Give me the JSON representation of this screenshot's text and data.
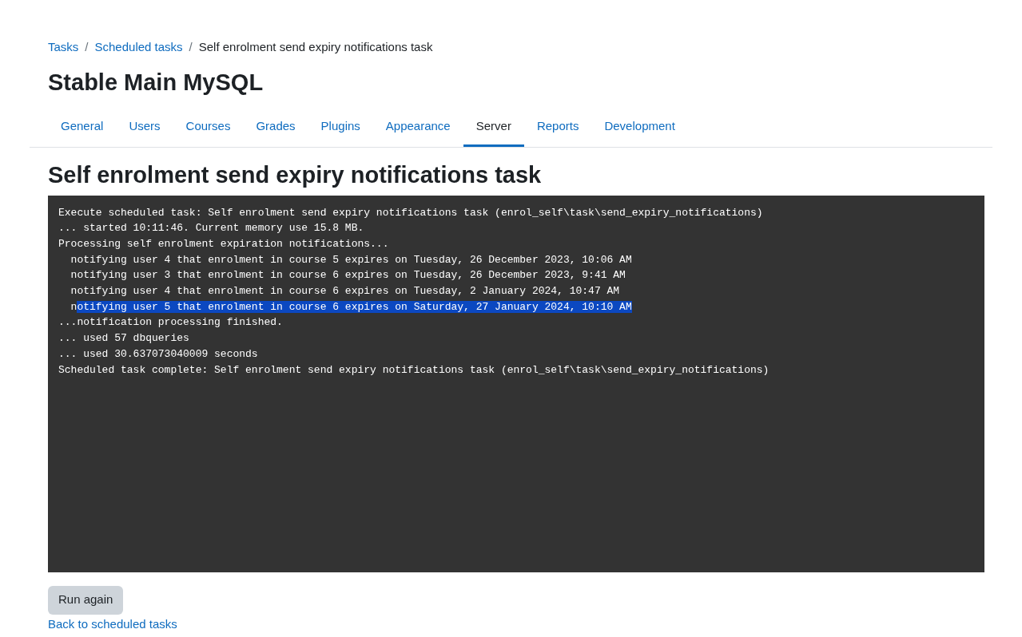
{
  "breadcrumb": [
    {
      "label": "Tasks",
      "link": true
    },
    {
      "label": "Scheduled tasks",
      "link": true
    },
    {
      "label": "Self enrolment send expiry notifications task",
      "link": false
    }
  ],
  "breadcrumb_separator": "/",
  "site_title": "Stable Main MySQL",
  "tabs": [
    {
      "label": "General",
      "selected": false
    },
    {
      "label": "Users",
      "selected": false
    },
    {
      "label": "Courses",
      "selected": false
    },
    {
      "label": "Grades",
      "selected": false
    },
    {
      "label": "Plugins",
      "selected": false
    },
    {
      "label": "Appearance",
      "selected": false
    },
    {
      "label": "Server",
      "selected": true
    },
    {
      "label": "Reports",
      "selected": false
    },
    {
      "label": "Development",
      "selected": false
    }
  ],
  "heading": "Self enrolment send expiry notifications task",
  "output_lines": [
    {
      "segments": [
        {
          "text": "Execute scheduled task: Self enrolment send expiry notifications task (enrol_self\\task\\send_expiry_notifications)",
          "highlighted": false
        }
      ]
    },
    {
      "segments": [
        {
          "text": "... started 10:11:46. Current memory use 15.8 MB.",
          "highlighted": false
        }
      ]
    },
    {
      "segments": [
        {
          "text": "Processing self enrolment expiration notifications...",
          "highlighted": false
        }
      ]
    },
    {
      "segments": [
        {
          "text": "  notifying user 4 that enrolment in course 5 expires on Tuesday, 26 December 2023, 10:06 AM",
          "highlighted": false
        }
      ]
    },
    {
      "segments": [
        {
          "text": "  notifying user 3 that enrolment in course 6 expires on Tuesday, 26 December 2023, 9:41 AM",
          "highlighted": false
        }
      ]
    },
    {
      "segments": [
        {
          "text": "  notifying user 4 that enrolment in course 6 expires on Tuesday, 2 January 2024, 10:47 AM",
          "highlighted": false
        }
      ]
    },
    {
      "segments": [
        {
          "text": "  n",
          "highlighted": false
        },
        {
          "text": "otifying user 5 that enrolment in course 6 expires on Saturday, 27 January 2024, 10:10 AM",
          "highlighted": true
        }
      ]
    },
    {
      "segments": [
        {
          "text": "...notification processing finished.",
          "highlighted": false
        }
      ]
    },
    {
      "segments": [
        {
          "text": "... used 57 dbqueries",
          "highlighted": false
        }
      ]
    },
    {
      "segments": [
        {
          "text": "... used 30.637073040009 seconds",
          "highlighted": false
        }
      ]
    },
    {
      "segments": [
        {
          "text": "Scheduled task complete: Self enrolment send expiry notifications task (enrol_self\\task\\send_expiry_notifications)",
          "highlighted": false
        }
      ]
    }
  ],
  "run_again_button": "Run again",
  "back_link": "Back to scheduled tasks"
}
